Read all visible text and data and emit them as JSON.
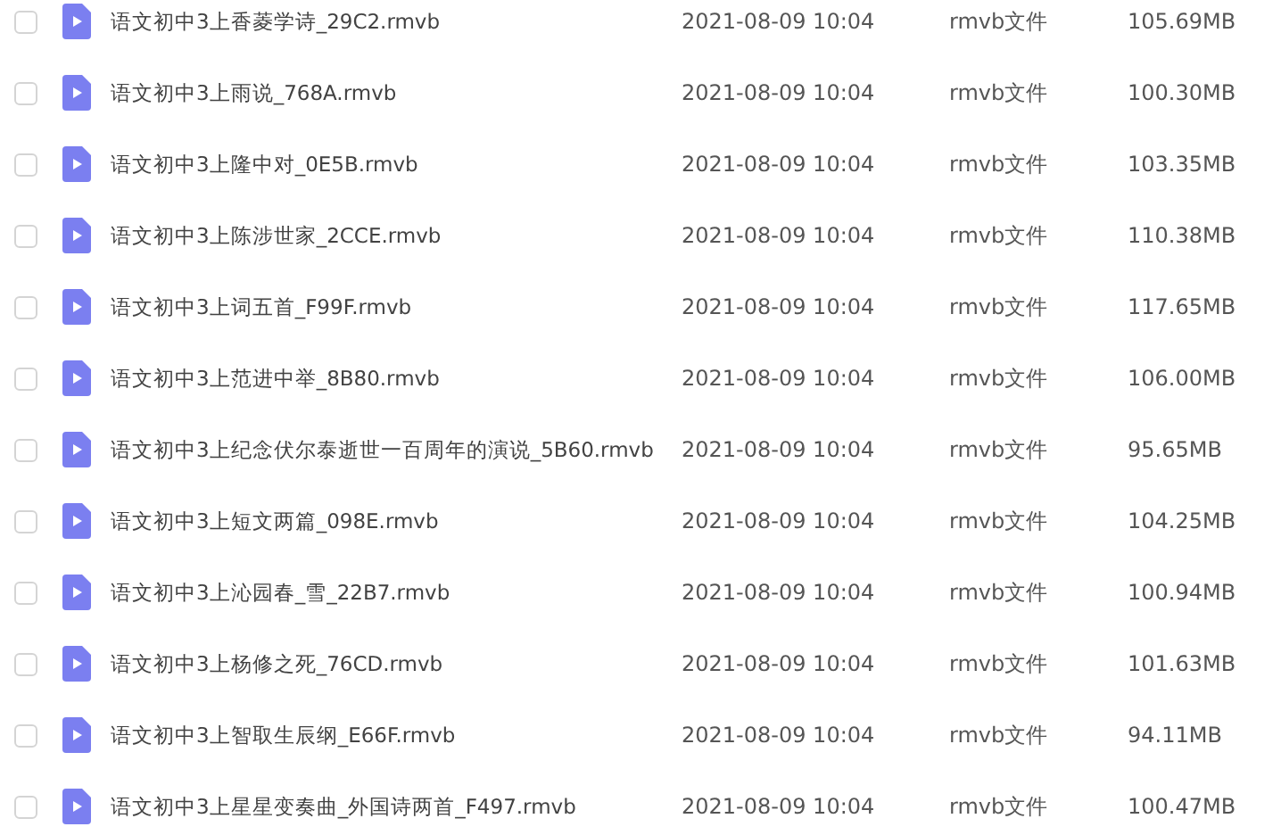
{
  "files": [
    {
      "name": "语文初中3上香菱学诗_29C2.rmvb",
      "modified": "2021-08-09 10:04",
      "type": "rmvb文件",
      "size": "105.69MB",
      "checked": false
    },
    {
      "name": "语文初中3上雨说_768A.rmvb",
      "modified": "2021-08-09 10:04",
      "type": "rmvb文件",
      "size": "100.30MB",
      "checked": false
    },
    {
      "name": "语文初中3上隆中对_0E5B.rmvb",
      "modified": "2021-08-09 10:04",
      "type": "rmvb文件",
      "size": "103.35MB",
      "checked": false
    },
    {
      "name": "语文初中3上陈涉世家_2CCE.rmvb",
      "modified": "2021-08-09 10:04",
      "type": "rmvb文件",
      "size": "110.38MB",
      "checked": false
    },
    {
      "name": "语文初中3上词五首_F99F.rmvb",
      "modified": "2021-08-09 10:04",
      "type": "rmvb文件",
      "size": "117.65MB",
      "checked": false
    },
    {
      "name": "语文初中3上范进中举_8B80.rmvb",
      "modified": "2021-08-09 10:04",
      "type": "rmvb文件",
      "size": "106.00MB",
      "checked": false
    },
    {
      "name": "语文初中3上纪念伏尔泰逝世一百周年的演说_5B60.rmvb",
      "modified": "2021-08-09 10:04",
      "type": "rmvb文件",
      "size": "95.65MB",
      "checked": false
    },
    {
      "name": "语文初中3上短文两篇_098E.rmvb",
      "modified": "2021-08-09 10:04",
      "type": "rmvb文件",
      "size": "104.25MB",
      "checked": false
    },
    {
      "name": "语文初中3上沁园春_雪_22B7.rmvb",
      "modified": "2021-08-09 10:04",
      "type": "rmvb文件",
      "size": "100.94MB",
      "checked": false
    },
    {
      "name": "语文初中3上杨修之死_76CD.rmvb",
      "modified": "2021-08-09 10:04",
      "type": "rmvb文件",
      "size": "101.63MB",
      "checked": false
    },
    {
      "name": "语文初中3上智取生辰纲_E66F.rmvb",
      "modified": "2021-08-09 10:04",
      "type": "rmvb文件",
      "size": "94.11MB",
      "checked": false
    },
    {
      "name": "语文初中3上星星变奏曲_外国诗两首_F497.rmvb",
      "modified": "2021-08-09 10:04",
      "type": "rmvb文件",
      "size": "100.47MB",
      "checked": false
    }
  ]
}
